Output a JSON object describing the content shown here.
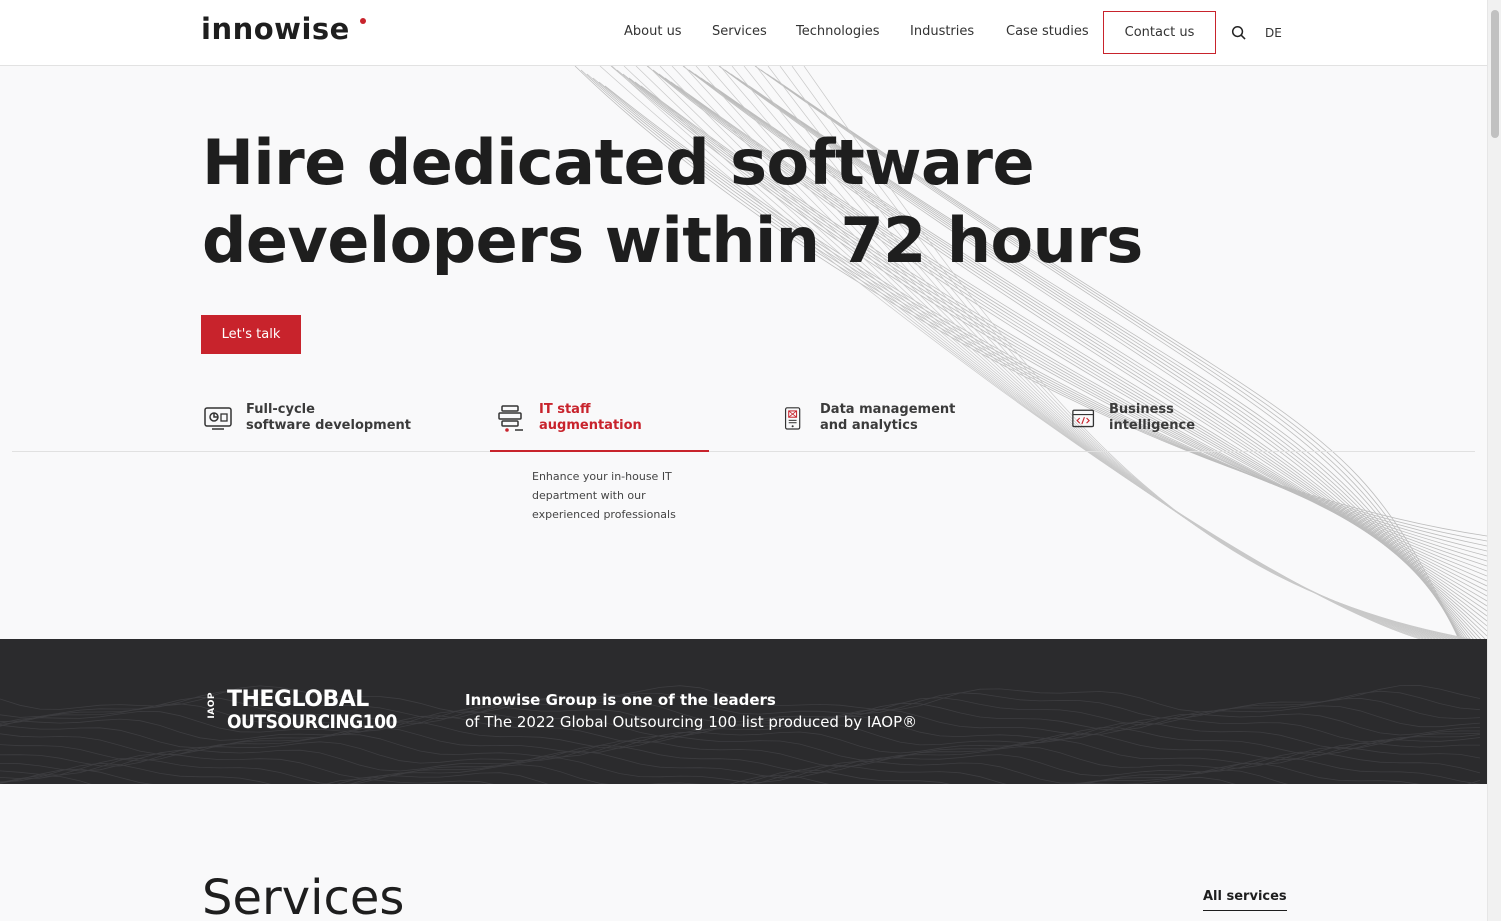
{
  "brand": {
    "name": "innowise",
    "accent": "#c8232c"
  },
  "nav": {
    "items": [
      "About us",
      "Services",
      "Technologies",
      "Industries",
      "Case studies"
    ],
    "contact_label": "Contact us",
    "lang": "DE"
  },
  "hero": {
    "title_line1": "Hire dedicated software",
    "title_line2": "developers within 72 hours",
    "cta": "Let's talk",
    "tabs": [
      {
        "line1": "Full-cycle",
        "line2": "software development",
        "icon": "monitor-icon"
      },
      {
        "line1": "IT staff",
        "line2": "augmentation",
        "icon": "staff-icon",
        "active": true
      },
      {
        "line1": "Data management",
        "line2": "and analytics",
        "icon": "mobile-analytics-icon"
      },
      {
        "line1": "Business",
        "line2": "intelligence",
        "icon": "code-window-icon"
      }
    ],
    "active_desc": "Enhance your in-house IT department with our experienced professionals"
  },
  "award": {
    "iaop": "IAOP",
    "logo_line1": "THEGLOBAL",
    "logo_line2": "OUTSOURCING100",
    "text_bold": "Innowise Group is one of the leaders",
    "text_regular": "of The 2022 Global Outsourcing 100 list produced by IAOP®"
  },
  "services": {
    "title": "Services",
    "all_link": "All services"
  }
}
